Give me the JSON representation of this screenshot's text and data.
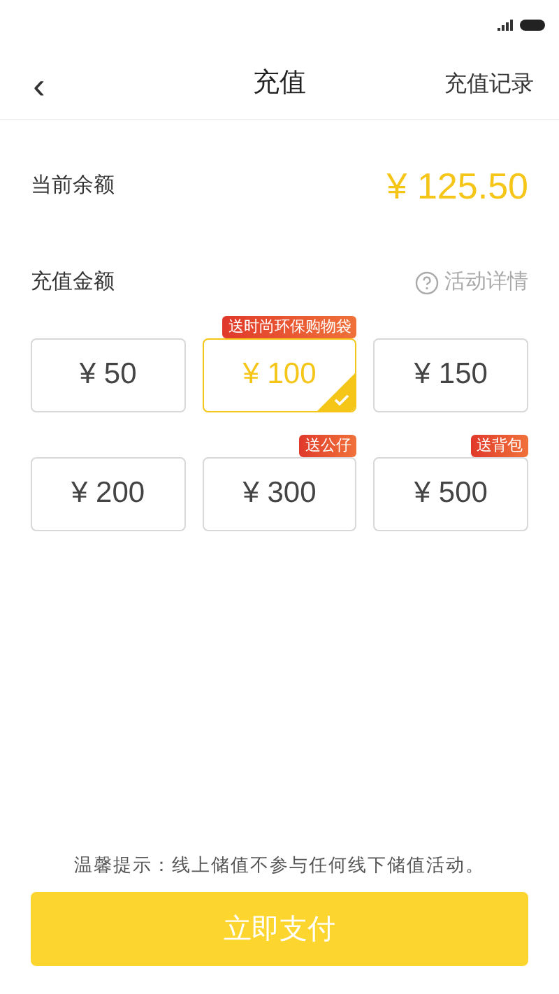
{
  "header": {
    "back": "‹",
    "title": "充值",
    "action": "充值记录"
  },
  "balance": {
    "label": "当前余额",
    "value": "¥ 125.50"
  },
  "amount_section": {
    "title": "充值金额",
    "details_link": "活动详情"
  },
  "options": [
    {
      "amount": "¥ 50",
      "selected": false
    },
    {
      "amount": "¥ 100",
      "selected": true,
      "badge": "送时尚环保购物袋"
    },
    {
      "amount": "¥ 150",
      "selected": false
    },
    {
      "amount": "¥ 200",
      "selected": false
    },
    {
      "amount": "¥ 300",
      "selected": false,
      "badge": "送公仔"
    },
    {
      "amount": "¥ 500",
      "selected": false,
      "badge": "送背包"
    }
  ],
  "notice": "温馨提示：线上储值不参与任何线下储值活动。",
  "pay_button": "立即支付"
}
